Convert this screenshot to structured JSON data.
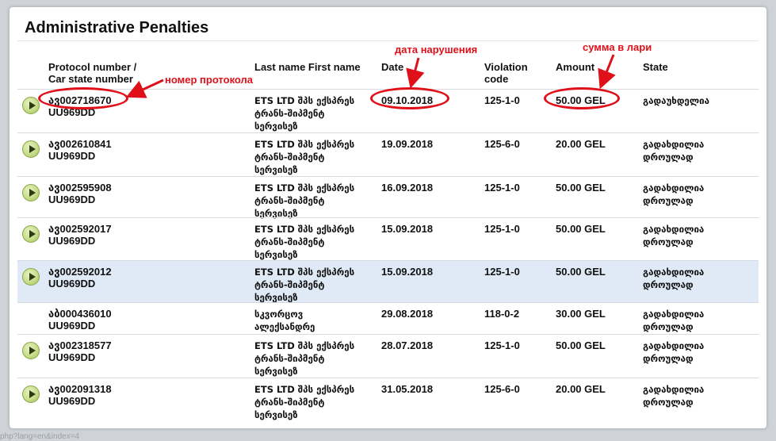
{
  "title": "Administrative Penalties",
  "columns": {
    "protocol": [
      "Protocol number /",
      "Car state number"
    ],
    "name": "Last name First name",
    "date": "Date",
    "code": [
      "Violation",
      "code"
    ],
    "amount": "Amount",
    "state": "State"
  },
  "rows": [
    {
      "protocol": "ავ002718670",
      "plate": "UU969DD",
      "name": [
        "ETS LTD შპს ექსპრეს",
        "ტრანს-შიპმენტ",
        "სერვისეზ"
      ],
      "date": "09.10.2018",
      "code": "125-1-0",
      "amount": "50.00 GEL",
      "state": [
        "გადაუხდელია"
      ],
      "has_play": true
    },
    {
      "protocol": "ავ002610841",
      "plate": "UU969DD",
      "name": [
        "ETS LTD შპს ექსპრეს",
        "ტრანს-შიპმენტ",
        "სერვისეზ"
      ],
      "date": "19.09.2018",
      "code": "125-6-0",
      "amount": "20.00 GEL",
      "state": [
        "გადახდილია",
        "დროულად"
      ],
      "has_play": true
    },
    {
      "protocol": "ავ002595908",
      "plate": "UU969DD",
      "name": [
        "ETS LTD შპს ექსპრეს",
        "ტრანს-შიპმენტ",
        "სერვისეზ"
      ],
      "date": "16.09.2018",
      "code": "125-1-0",
      "amount": "50.00 GEL",
      "state": [
        "გადახდილია",
        "დროულად"
      ],
      "has_play": true
    },
    {
      "protocol": "ავ002592017",
      "plate": "UU969DD",
      "name": [
        "ETS LTD შპს ექსპრეს",
        "ტრანს-შიპმენტ",
        "სერვისეზ"
      ],
      "date": "15.09.2018",
      "code": "125-1-0",
      "amount": "50.00 GEL",
      "state": [
        "გადახდილია",
        "დროულად"
      ],
      "has_play": true
    },
    {
      "protocol": "ავ002592012",
      "plate": "UU969DD",
      "name": [
        "ETS LTD შპს ექსპრეს",
        "ტრანს-შიპმენტ",
        "სერვისეზ"
      ],
      "date": "15.09.2018",
      "code": "125-1-0",
      "amount": "50.00 GEL",
      "state": [
        "გადახდილია",
        "დროულად"
      ],
      "has_play": true,
      "highlighted": true
    },
    {
      "protocol": "აბ000436010",
      "plate": "UU969DD",
      "name": [
        "სკვორცოვ",
        "ალექსანდრე"
      ],
      "date": "29.08.2018",
      "code": "118-0-2",
      "amount": "30.00 GEL",
      "state": [
        "გადახდილია",
        "დროულად"
      ],
      "has_play": false
    },
    {
      "protocol": "ავ002318577",
      "plate": "UU969DD",
      "name": [
        "ETS LTD შპს ექსპრეს",
        "ტრანს-შიპმენტ",
        "სერვისეზ"
      ],
      "date": "28.07.2018",
      "code": "125-1-0",
      "amount": "50.00 GEL",
      "state": [
        "გადახდილია",
        "დროულად"
      ],
      "has_play": true
    },
    {
      "protocol": "ავ002091318",
      "plate": "UU969DD",
      "name": [
        "ETS LTD შპს ექსპრეს",
        "ტრანს-შიპმენტ",
        "სერვისეზ"
      ],
      "date": "31.05.2018",
      "code": "125-6-0",
      "amount": "20.00 GEL",
      "state": [
        "გადახდილია",
        "დროულად"
      ],
      "has_play": true
    }
  ],
  "annotations": {
    "protocol": "номер протокола",
    "date": "дата нарушения",
    "amount": "сумма в лари",
    "color": "#e0101b"
  },
  "footer_url": "php?lang=en&index=4"
}
